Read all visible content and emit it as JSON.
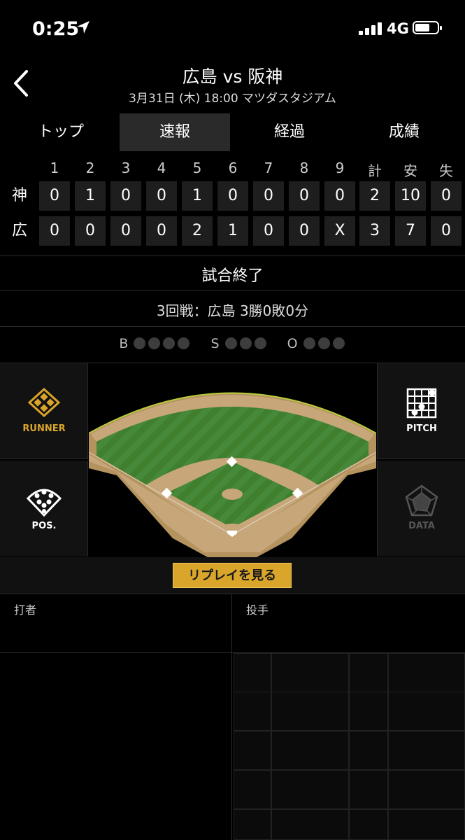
{
  "status_bar": {
    "time": "0:25",
    "network": "4G"
  },
  "header": {
    "title": "広島 vs 阪神",
    "info": "3月31日 (木) 18:00 マツダスタジアム"
  },
  "tabs": [
    {
      "label": "トップ",
      "active": false
    },
    {
      "label": "速報",
      "active": true
    },
    {
      "label": "経過",
      "active": false
    },
    {
      "label": "成績",
      "active": false
    }
  ],
  "scoreboard": {
    "headers": [
      "1",
      "2",
      "3",
      "4",
      "5",
      "6",
      "7",
      "8",
      "9",
      "計",
      "安",
      "失"
    ],
    "teams": [
      {
        "name": "神",
        "scores": [
          "0",
          "1",
          "0",
          "0",
          "1",
          "0",
          "0",
          "0",
          "0",
          "2",
          "10",
          "0"
        ]
      },
      {
        "name": "広",
        "scores": [
          "0",
          "0",
          "0",
          "0",
          "2",
          "1",
          "0",
          "0",
          "X",
          "3",
          "7",
          "0"
        ]
      }
    ]
  },
  "game_status": "試合終了",
  "series": "3回戦：広島 3勝0敗0分",
  "count": {
    "ball_label": "B",
    "strike_label": "S",
    "out_label": "O"
  },
  "panels": {
    "runner": "RUNNER",
    "pos": "POS.",
    "pitch": "PITCH",
    "data": "DATA"
  },
  "replay_button": "リプレイを見る",
  "batter_label": "打者",
  "pitcher_label": "投手",
  "colors": {
    "accent": "#d9a52b",
    "field_green": "#3d7a2d",
    "dirt": "#c7a679"
  }
}
